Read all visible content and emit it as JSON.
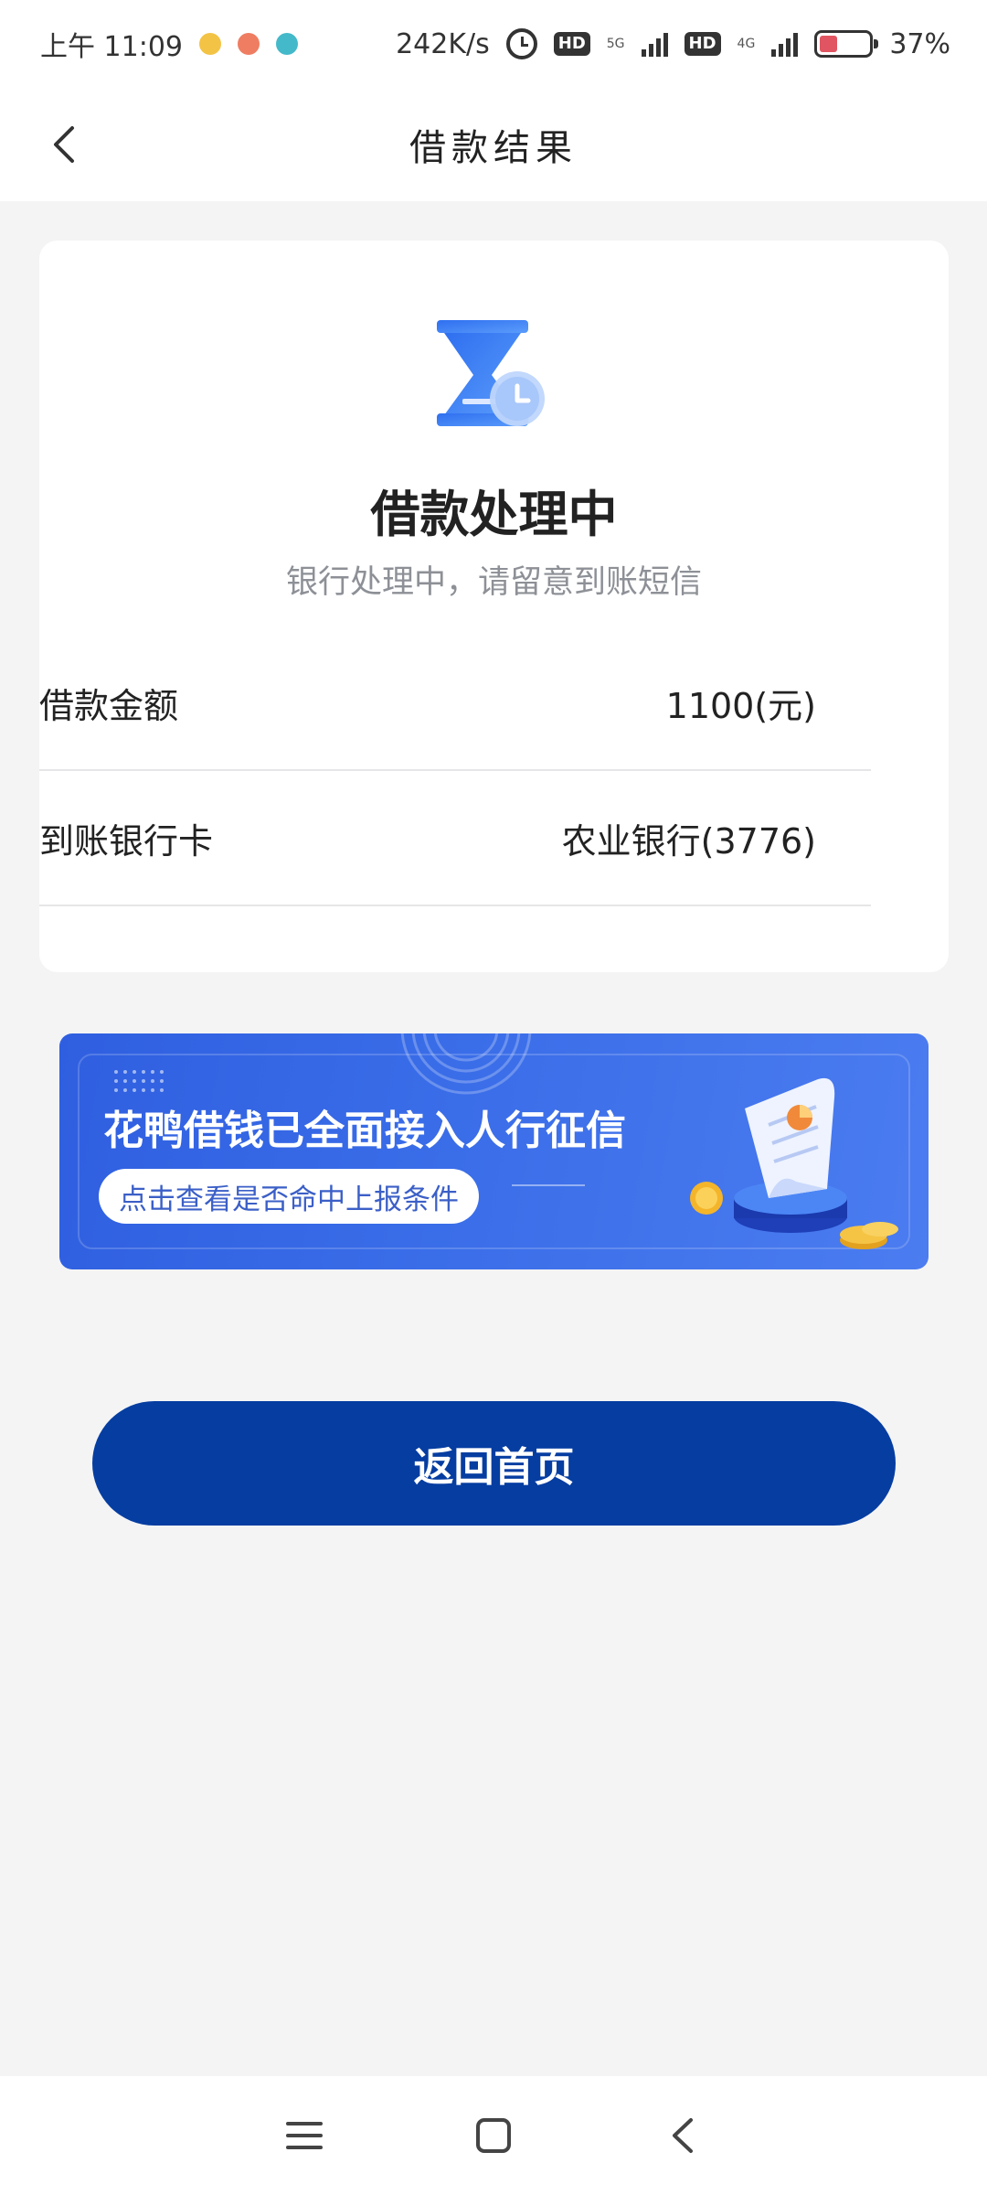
{
  "status_bar": {
    "time": "上午 11:09",
    "net_speed": "242K/s",
    "hd_label": "HD",
    "signal_1_type": "5G",
    "signal_2_type": "4G",
    "battery": "37%",
    "battery_level": 0.37
  },
  "nav": {
    "title": "借款结果",
    "back_icon": "chevron-left-icon"
  },
  "result": {
    "icon": "hourglass-clock-icon",
    "title": "借款处理中",
    "subtitle": "银行处理中，请留意到账短信",
    "rows": [
      {
        "label": "借款金额",
        "value": "1100(元)"
      },
      {
        "label": "到账银行卡",
        "value": "农业银行(3776)"
      }
    ]
  },
  "banner": {
    "title": "花鸭借钱已全面接入人行征信",
    "cta": "点击查看是否命中上报条件"
  },
  "actions": {
    "home_label": "返回首页"
  },
  "system_nav": {
    "menu_icon": "menu-icon",
    "home_icon": "home-square-icon",
    "back_icon": "back-triangle-icon"
  },
  "colors": {
    "primary_button": "#053da1",
    "banner": "#3a6de8",
    "icon_blue": "#3f86f5",
    "page_bg": "#f4f4f5"
  }
}
